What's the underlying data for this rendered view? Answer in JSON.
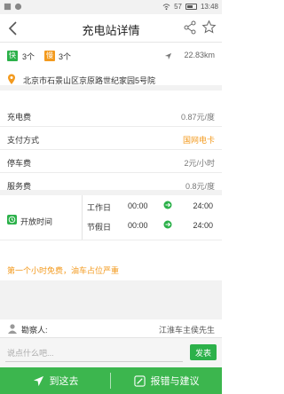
{
  "statusbar": {
    "signal": "57",
    "time": "13:48"
  },
  "header": {
    "title": "充电站详情"
  },
  "counts": {
    "fast_tag": "快",
    "fast_count": "3个",
    "slow_tag": "慢",
    "slow_count": "3个",
    "distance": "22.83km"
  },
  "address": "北京市石景山区京原路世纪家园5号院",
  "fees": [
    {
      "label": "充电费",
      "value": "0.87元/度"
    },
    {
      "label": "支付方式",
      "value": "国网电卡"
    },
    {
      "label": "停车费",
      "value": "2元/小时"
    },
    {
      "label": "服务费",
      "value": "0.8元/度"
    }
  ],
  "hours": {
    "label": "开放时间",
    "rows": [
      {
        "day": "工作日",
        "start": "00:00",
        "end": "24:00"
      },
      {
        "day": "节假日",
        "start": "00:00",
        "end": "24:00"
      }
    ]
  },
  "notice": "第一个小时免费，油车占位严重",
  "reviewer": {
    "label": "勘察人:",
    "name": "江淮车主侯先生"
  },
  "compose": {
    "placeholder": "说点什么吧...",
    "send": "发表"
  },
  "actions": {
    "go": "到这去",
    "report": "报错与建议"
  },
  "colors": {
    "green": "#2cb14a",
    "orange": "#f39a1e"
  }
}
